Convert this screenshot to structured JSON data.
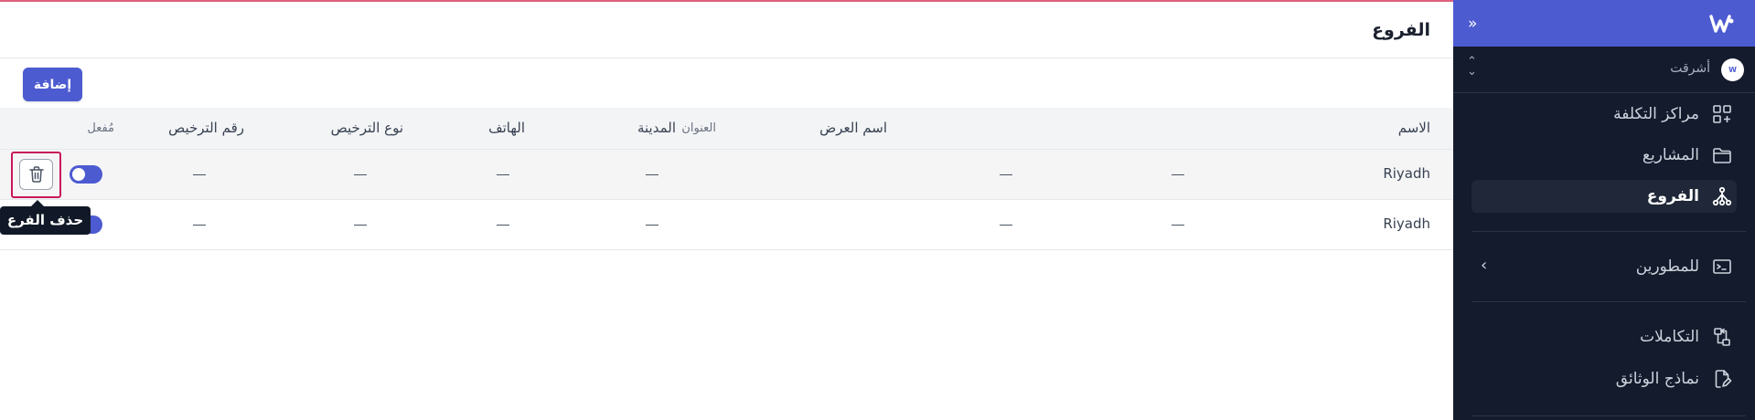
{
  "page": {
    "title": "الفروع",
    "add_label": "إضافة"
  },
  "table": {
    "headers": {
      "name": "الاسم",
      "display_name": "اسم العرض",
      "address": "العنوان",
      "city": "المدينة",
      "phone": "الهاتف",
      "license_type": "نوع الترخيص",
      "license_number": "رقم الترخيص",
      "enabled": "مُفعل"
    },
    "rows": [
      {
        "name": "Riyadh",
        "display_name": "—",
        "address": "—",
        "city": "—",
        "phone": "—",
        "license_type": "—",
        "license_number": "—",
        "enabled": true
      },
      {
        "name": "Riyadh",
        "display_name": "—",
        "address": "—",
        "city": "—",
        "phone": "—",
        "license_type": "—",
        "license_number": "—",
        "enabled": true
      }
    ]
  },
  "tooltip": {
    "delete_branch": "حذف الفرع"
  },
  "sidebar": {
    "org": {
      "name": "أشرقت",
      "avatar_text": "W"
    },
    "items": [
      {
        "label": "مراكز التكلفة",
        "icon": "grid-plus-icon",
        "active": false
      },
      {
        "label": "المشاريع",
        "icon": "folder-icon",
        "active": false
      },
      {
        "label": "الفروع",
        "icon": "branches-icon",
        "active": true
      },
      {
        "label": "للمطورين",
        "icon": "terminal-icon",
        "active": false
      },
      {
        "label": "التكاملات",
        "icon": "integrations-icon",
        "active": false
      },
      {
        "label": "نماذج الوثائق",
        "icon": "document-edit-icon",
        "active": false
      }
    ]
  },
  "colors": {
    "accent": "#4d5bd1",
    "sidebar_bg": "#141b2d",
    "focus_ring": "#c8185a"
  }
}
